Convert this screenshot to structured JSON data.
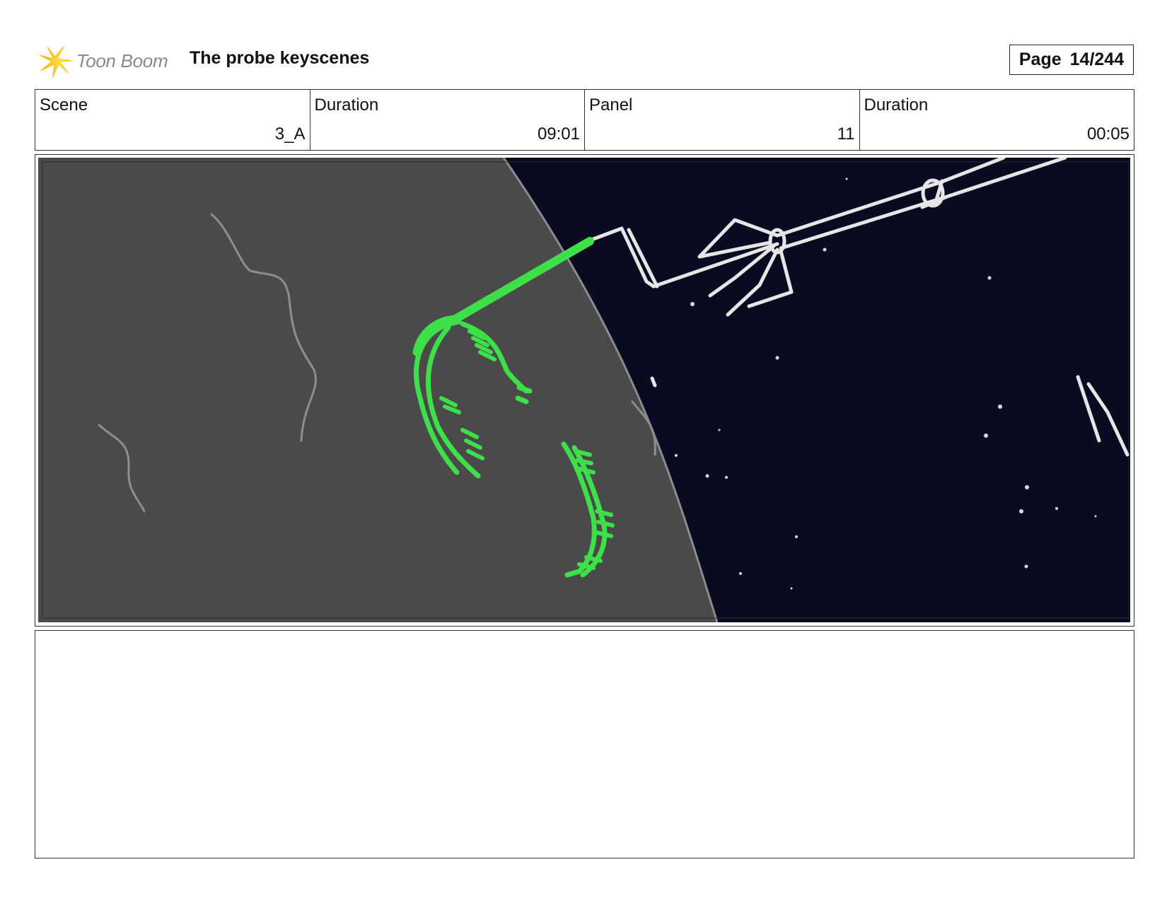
{
  "header": {
    "logo_text": "Toon Boom",
    "title": "The probe keyscenes",
    "page_label": "Page",
    "page_number": "14/244"
  },
  "info": {
    "scene": {
      "label": "Scene",
      "value": "3_A"
    },
    "scene_duration": {
      "label": "Duration",
      "value": "09:01"
    },
    "panel": {
      "label": "Panel",
      "value": "11"
    },
    "panel_duration": {
      "label": "Duration",
      "value": "00:05"
    }
  },
  "panel_image": {
    "planet_color": "#4a4a4a",
    "space_color": "#090b21",
    "sketch_green": "#3ee04a",
    "sketch_white": "#e8e8e8"
  },
  "notes": {
    "text": ""
  }
}
